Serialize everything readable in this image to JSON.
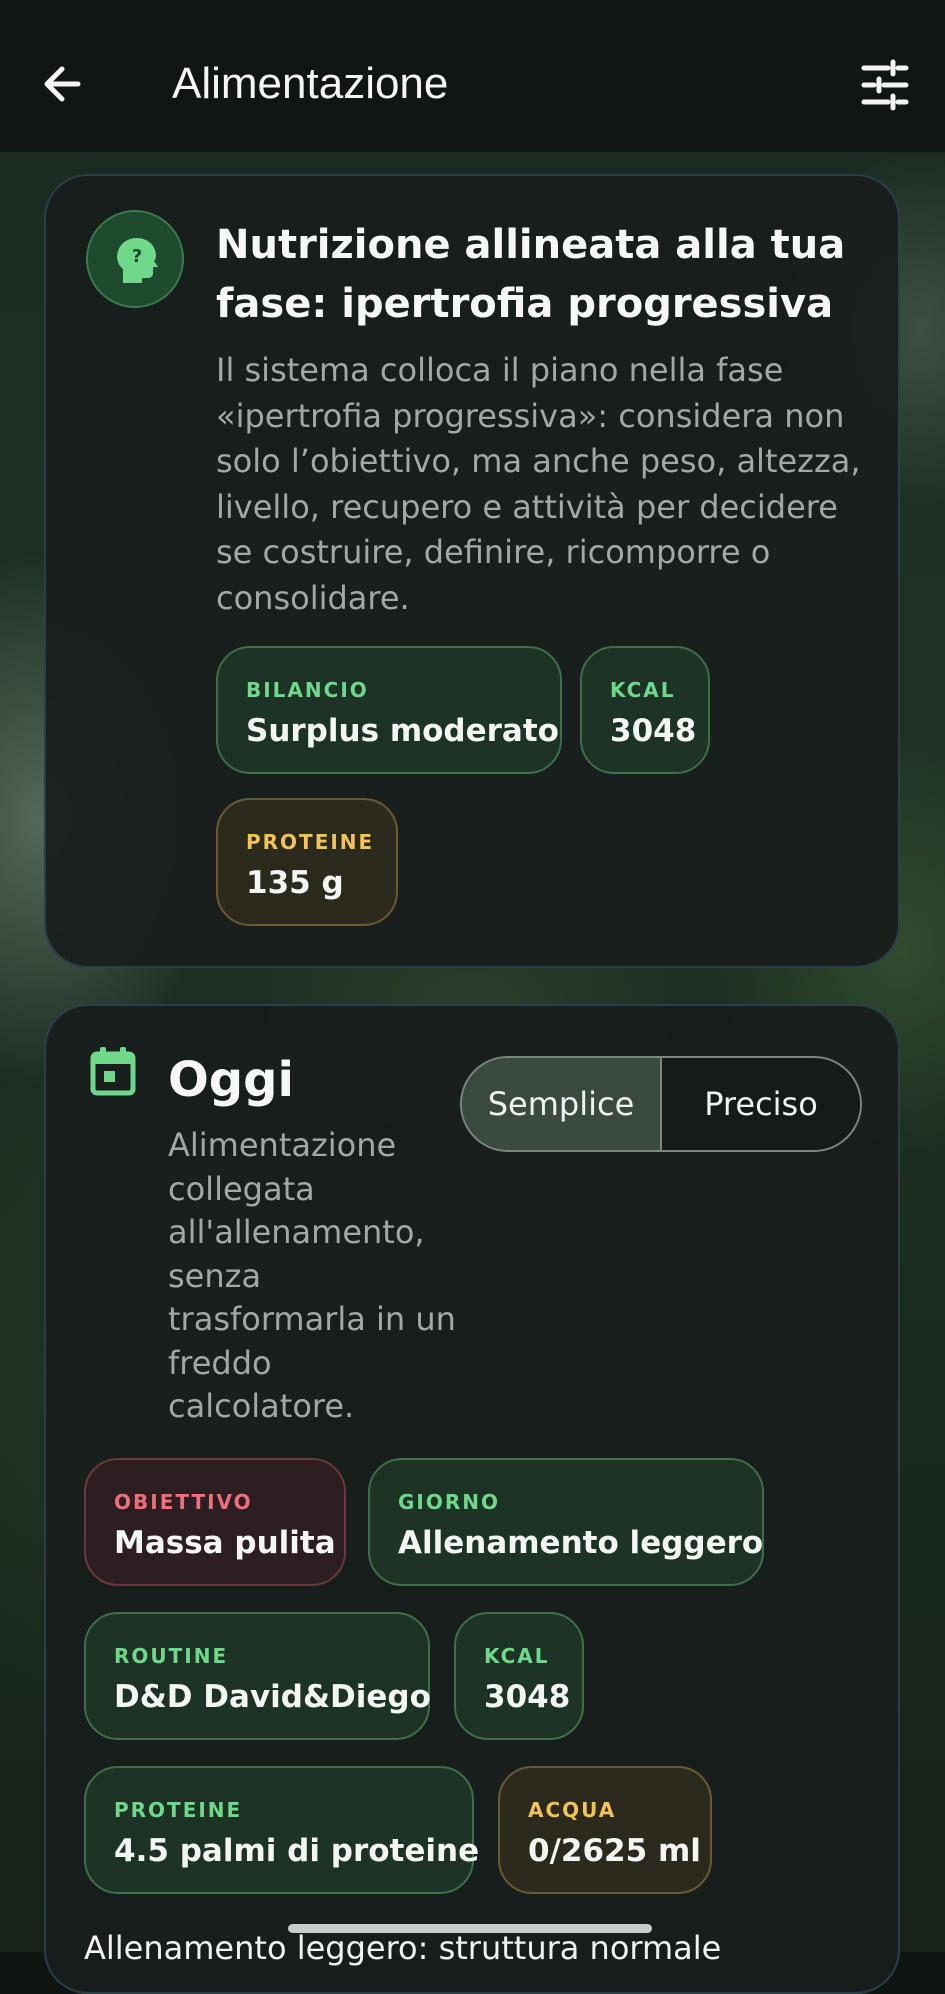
{
  "appbar": {
    "title": "Alimentazione",
    "back_icon": "arrow-left-icon",
    "filter_icon": "tune-sliders-icon"
  },
  "phase_card": {
    "icon": "help-head-icon",
    "title": "Nutrizione allineata alla tua fase: ipertrofia progressiva",
    "description": "Il sistema colloca il piano nella fase «ipertrofia progressiva»: considera non solo l’obiettivo, ma anche peso, altezza, livello, recupero e attività per decidere se costruire, definire, ricomporre o consolidare.",
    "chips": [
      {
        "label": "BILANCIO",
        "value": "Surplus moderato",
        "tone": "green"
      },
      {
        "label": "KCAL",
        "value": "3048",
        "tone": "green"
      },
      {
        "label": "PROTEINE",
        "value": "135 g",
        "tone": "amber"
      }
    ]
  },
  "today_card": {
    "icon": "calendar-icon",
    "title": "Oggi",
    "description": "Alimentazione collegata all'allenamento, senza trasformarla in un freddo calcolatore.",
    "mode_toggle": {
      "options": [
        "Semplice",
        "Preciso"
      ],
      "selected": "Semplice"
    },
    "chips": [
      {
        "label": "OBIETTIVO",
        "value": "Massa pulita",
        "tone": "red"
      },
      {
        "label": "GIORNO",
        "value": "Allenamento leggero",
        "tone": "green"
      },
      {
        "label": "ROUTINE",
        "value": "D&D David&Diego",
        "tone": "green"
      },
      {
        "label": "KCAL",
        "value": "3048",
        "tone": "green"
      },
      {
        "label": "PROTEINE",
        "value": "4.5 palmi di proteine",
        "tone": "green"
      },
      {
        "label": "ACQUA",
        "value": "0/2625 ml",
        "tone": "amber"
      }
    ],
    "footer_text": "Allenamento leggero: struttura normale"
  },
  "colors": {
    "accent_green": "#6fd88a",
    "accent_amber": "#f2c35a",
    "accent_red": "#ee6f7c",
    "card_bg": "#181e1c",
    "appbar_bg": "#111513"
  }
}
